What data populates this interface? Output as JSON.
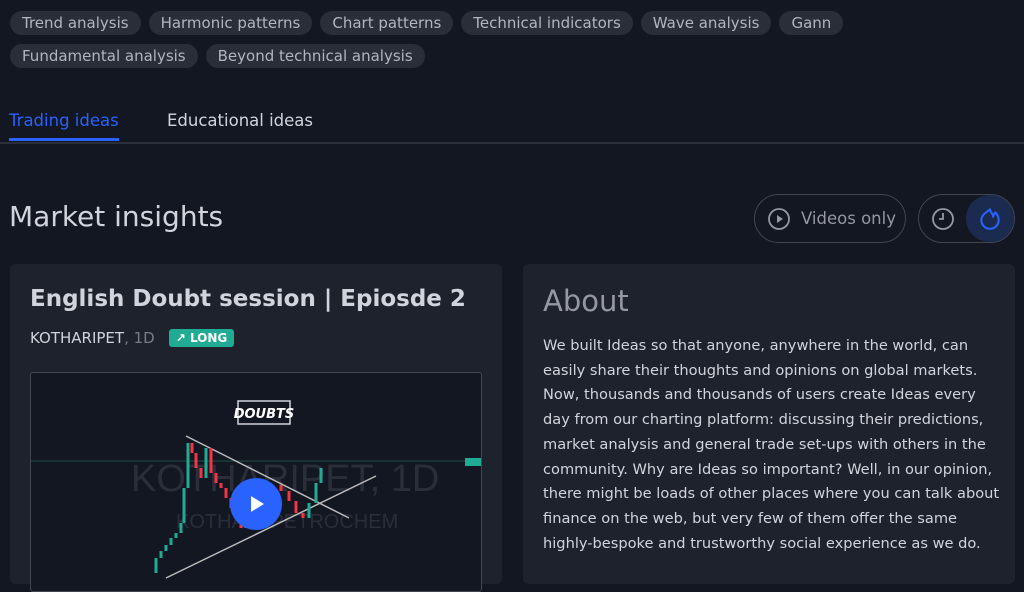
{
  "tags": [
    "Trend analysis",
    "Harmonic patterns",
    "Chart patterns",
    "Technical indicators",
    "Wave analysis",
    "Gann",
    "Fundamental analysis",
    "Beyond technical analysis"
  ],
  "tabs": [
    {
      "label": "Trading ideas",
      "active": true
    },
    {
      "label": "Educational ideas",
      "active": false
    }
  ],
  "section": {
    "title": "Market insights",
    "videos_only": "Videos only",
    "sort_icons": [
      "clock-icon",
      "flame-icon"
    ],
    "active_sort": "flame-icon"
  },
  "idea": {
    "title": "English Doubt session | Epiosde 2",
    "symbol": "KOTHARIPET",
    "interval": ", 1D",
    "direction": "LONG",
    "direction_color": "#22ab94",
    "thumb_label": "DOUBTS",
    "watermark": "KOTHARIPET, 1D",
    "watermark2": "KOTHARI PETROCHEM"
  },
  "about": {
    "title": "About",
    "text": "We built Ideas so that anyone, anywhere in the world, can easily share their thoughts and opinions on global markets. Now, thousands and thousands of users create Ideas every day from our charting platform: discussing their predictions, market analysis and general trade set-ups with others in the community. Why are Ideas so important? Well, in our opinion, there might be loads of other places where you can talk about finance on the web, but very few of them offer the same highly-bespoke and trustworthy social experience as we do."
  },
  "colors": {
    "accent": "#2962ff",
    "long": "#22ab94",
    "bg": "#131722",
    "card": "#1e222d"
  }
}
